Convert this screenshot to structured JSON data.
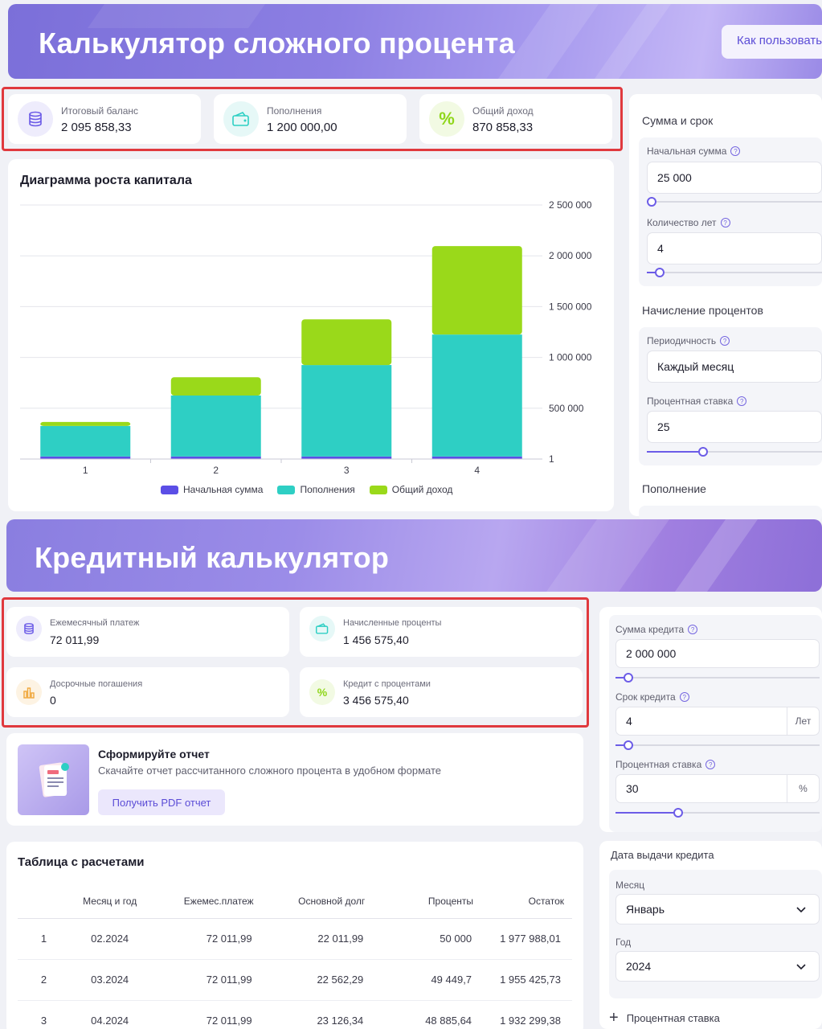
{
  "compound": {
    "title": "Калькулятор сложного процента",
    "how_to_label": "Как пользовать",
    "stats": [
      {
        "label": "Итоговый баланс",
        "value": "2 095 858,33",
        "icon": "coins-stack-icon",
        "color": "#6c5ce7"
      },
      {
        "label": "Пополнения",
        "value": "1 200 000,00",
        "icon": "wallet-icon",
        "color": "#2ecfc4"
      },
      {
        "label": "Общий доход",
        "value": "870 858,33",
        "icon": "percent-icon",
        "color": "#8fd61a"
      }
    ],
    "chart_title": "Диаграмма роста капитала",
    "sidebar": {
      "sum_term_title": "Сумма и срок",
      "initial_label": "Начальная сумма",
      "initial_value": "25 000",
      "initial_slider": 0.02,
      "years_label": "Количество лет",
      "years_value": "4",
      "years_slider": 0.06,
      "interest_title": "Начисление процентов",
      "period_label": "Периодичность",
      "period_value": "Каждый месяц",
      "rate_label": "Процентная ставка",
      "rate_value": "25",
      "rate_slider": 0.3,
      "topup_title": "Пополнение"
    }
  },
  "chart_data": {
    "type": "bar",
    "stacked": true,
    "categories": [
      "1",
      "2",
      "3",
      "4"
    ],
    "series": [
      {
        "name": "Начальная сумма",
        "color": "#5b4ee6",
        "values": [
          25000,
          25000,
          25000,
          25000
        ]
      },
      {
        "name": "Пополнения",
        "color": "#2ecfc4",
        "values": [
          300000,
          600000,
          900000,
          1200000
        ]
      },
      {
        "name": "Общий доход",
        "color": "#9ad91a",
        "values": [
          40000,
          180000,
          450000,
          870858
        ]
      }
    ],
    "y_ticks": [
      "1",
      "500 000",
      "1 000 000",
      "1 500 000",
      "2 000 000",
      "2 500 000"
    ],
    "ylim": [
      0,
      2500000
    ],
    "grid": true,
    "legend": "bottom"
  },
  "credit": {
    "title": "Кредитный калькулятор",
    "stats": [
      {
        "label": "Ежемесячный платеж",
        "value": "72 011,99",
        "icon": "coins-stack-icon",
        "color": "#6c5ce7"
      },
      {
        "label": "Начисленные проценты",
        "value": "1 456 575,40",
        "icon": "wallet-icon",
        "color": "#2ecfc4"
      },
      {
        "label": "Досрочные погашения",
        "value": "0",
        "icon": "bar-chart-icon",
        "color": "#f0a63a"
      },
      {
        "label": "Кредит с процентами",
        "value": "3 456 575,40",
        "icon": "percent-icon",
        "color": "#8fd61a"
      }
    ],
    "report": {
      "title": "Сформируйте отчет",
      "subtitle": "Скачайте отчет рассчитанного сложного процента в удобном формате",
      "button": "Получить PDF отчет"
    },
    "table": {
      "title": "Таблица с расчетами",
      "headers": [
        "",
        "Месяц и год",
        "Ежемес.платеж",
        "Основной долг",
        "Проценты",
        "Остаток"
      ],
      "rows": [
        [
          "1",
          "02.2024",
          "72 011,99",
          "22 011,99",
          "50 000",
          "1 977 988,01"
        ],
        [
          "2",
          "03.2024",
          "72 011,99",
          "22 562,29",
          "49 449,7",
          "1 955 425,73"
        ],
        [
          "3",
          "04.2024",
          "72 011,99",
          "23 126,34",
          "48 885,64",
          "1 932 299,38"
        ]
      ]
    },
    "sidebar": {
      "amount_label": "Сумма кредита",
      "amount_value": "2 000 000",
      "amount_slider": 0.06,
      "term_label": "Срок кредита",
      "term_value": "4",
      "term_unit": "Лет",
      "term_slider": 0.06,
      "rate_label": "Процентная ставка",
      "rate_value": "30",
      "rate_unit": "%",
      "rate_slider": 0.32,
      "date_title": "Дата выдачи кредита",
      "month_label": "Месяц",
      "month_value": "Январь",
      "year_label": "Год",
      "year_value": "2024",
      "add_rate_label": "Процентная ставка"
    }
  }
}
